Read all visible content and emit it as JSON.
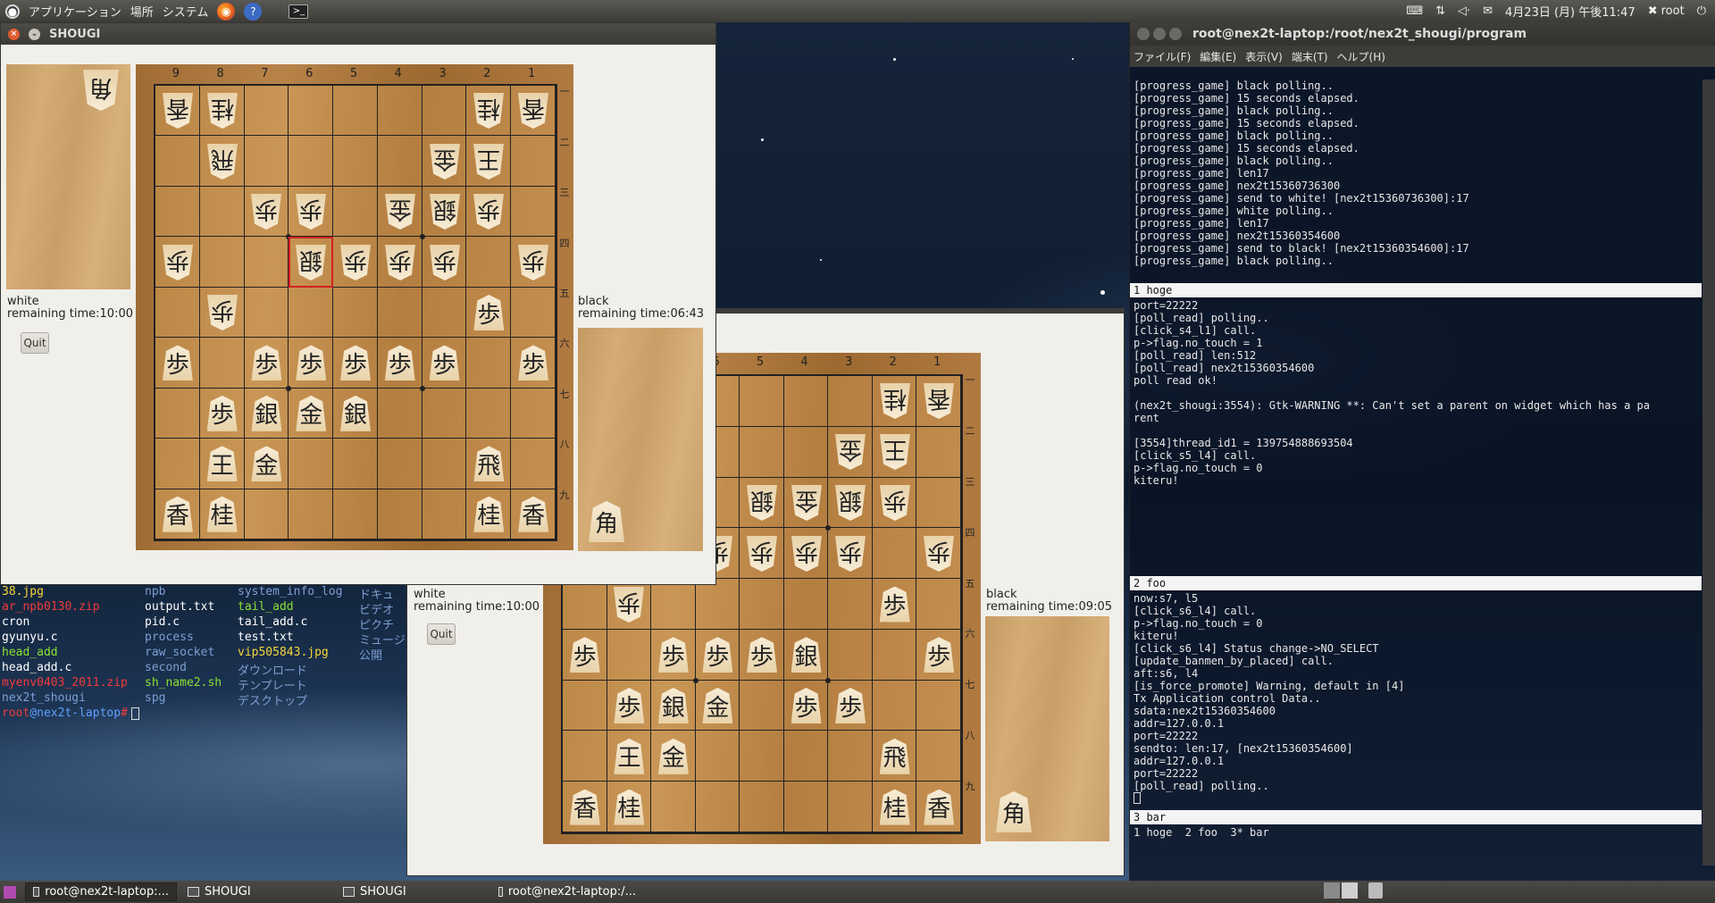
{
  "top_panel": {
    "applications": "アプリケーション",
    "places": "場所",
    "system": "システム",
    "datetime": "4月23日 (月) 午後11:47",
    "user": "root"
  },
  "shogi1": {
    "title": "SHOUGI",
    "white_label": "white",
    "white_time": "remaining time:10:00",
    "black_label": "black",
    "black_time": "remaining time:06:43",
    "quit": "Quit",
    "cols": [
      "9",
      "8",
      "7",
      "6",
      "5",
      "4",
      "3",
      "2",
      "1"
    ],
    "rows": [
      "一",
      "二",
      "三",
      "四",
      "五",
      "六",
      "七",
      "八",
      "九"
    ],
    "captured_white": "角",
    "captured_black": "角",
    "pieces": [
      {
        "c": 9,
        "r": 1,
        "k": "香",
        "w": true
      },
      {
        "c": 8,
        "r": 1,
        "k": "桂",
        "w": true
      },
      {
        "c": 2,
        "r": 1,
        "k": "桂",
        "w": true
      },
      {
        "c": 1,
        "r": 1,
        "k": "香",
        "w": true
      },
      {
        "c": 8,
        "r": 2,
        "k": "飛",
        "w": true
      },
      {
        "c": 3,
        "r": 2,
        "k": "金",
        "w": true
      },
      {
        "c": 2,
        "r": 2,
        "k": "王",
        "w": true
      },
      {
        "c": 7,
        "r": 3,
        "k": "歩",
        "w": true
      },
      {
        "c": 6,
        "r": 3,
        "k": "歩",
        "w": true
      },
      {
        "c": 4,
        "r": 3,
        "k": "金",
        "w": true
      },
      {
        "c": 3,
        "r": 3,
        "k": "銀",
        "w": true
      },
      {
        "c": 2,
        "r": 3,
        "k": "歩",
        "w": true
      },
      {
        "c": 9,
        "r": 4,
        "k": "歩",
        "w": true
      },
      {
        "c": 6,
        "r": 4,
        "k": "銀",
        "w": true
      },
      {
        "c": 5,
        "r": 4,
        "k": "歩",
        "w": true
      },
      {
        "c": 4,
        "r": 4,
        "k": "歩",
        "w": true
      },
      {
        "c": 3,
        "r": 4,
        "k": "歩",
        "w": true
      },
      {
        "c": 1,
        "r": 4,
        "k": "歩",
        "w": true
      },
      {
        "c": 8,
        "r": 5,
        "k": "歩",
        "w": true
      },
      {
        "c": 2,
        "r": 5,
        "k": "歩",
        "w": false
      },
      {
        "c": 9,
        "r": 6,
        "k": "歩",
        "w": false
      },
      {
        "c": 7,
        "r": 6,
        "k": "歩",
        "w": false
      },
      {
        "c": 6,
        "r": 6,
        "k": "歩",
        "w": false
      },
      {
        "c": 5,
        "r": 6,
        "k": "歩",
        "w": false
      },
      {
        "c": 4,
        "r": 6,
        "k": "歩",
        "w": false
      },
      {
        "c": 3,
        "r": 6,
        "k": "歩",
        "w": false
      },
      {
        "c": 1,
        "r": 6,
        "k": "歩",
        "w": false
      },
      {
        "c": 8,
        "r": 7,
        "k": "歩",
        "w": false
      },
      {
        "c": 7,
        "r": 7,
        "k": "銀",
        "w": false
      },
      {
        "c": 6,
        "r": 7,
        "k": "金",
        "w": false
      },
      {
        "c": 5,
        "r": 7,
        "k": "銀",
        "w": false
      },
      {
        "c": 8,
        "r": 8,
        "k": "王",
        "w": false
      },
      {
        "c": 7,
        "r": 8,
        "k": "金",
        "w": false
      },
      {
        "c": 2,
        "r": 8,
        "k": "飛",
        "w": false
      },
      {
        "c": 9,
        "r": 9,
        "k": "香",
        "w": false
      },
      {
        "c": 8,
        "r": 9,
        "k": "桂",
        "w": false
      },
      {
        "c": 2,
        "r": 9,
        "k": "桂",
        "w": false
      },
      {
        "c": 1,
        "r": 9,
        "k": "香",
        "w": false
      }
    ],
    "selected": {
      "c": 6,
      "r": 4
    }
  },
  "shogi2": {
    "title": "SHOUGI",
    "white_label": "white",
    "white_time": "remaining time:10:00",
    "black_label": "black",
    "black_time": "remaining time:09:05",
    "quit": "Quit",
    "cols": [
      "6",
      "5",
      "4",
      "3",
      "2",
      "1"
    ],
    "rows": [
      "一",
      "二",
      "三",
      "四",
      "五",
      "六",
      "七",
      "八",
      "九"
    ],
    "captured_black": "角",
    "pieces": [
      {
        "c": 2,
        "r": 1,
        "k": "桂",
        "w": true
      },
      {
        "c": 1,
        "r": 1,
        "k": "香",
        "w": true
      },
      {
        "c": 3,
        "r": 2,
        "k": "金",
        "w": true
      },
      {
        "c": 2,
        "r": 2,
        "k": "王",
        "w": true
      },
      {
        "c": 5,
        "r": 3,
        "k": "銀",
        "w": true
      },
      {
        "c": 4,
        "r": 3,
        "k": "金",
        "w": true
      },
      {
        "c": 3,
        "r": 3,
        "k": "銀",
        "w": true
      },
      {
        "c": 2,
        "r": 3,
        "k": "歩",
        "w": true
      },
      {
        "c": 6,
        "r": 4,
        "k": "歩",
        "w": true
      },
      {
        "c": 5,
        "r": 4,
        "k": "歩",
        "w": true
      },
      {
        "c": 4,
        "r": 4,
        "k": "歩",
        "w": true
      },
      {
        "c": 3,
        "r": 4,
        "k": "歩",
        "w": true
      },
      {
        "c": 1,
        "r": 4,
        "k": "歩",
        "w": true
      },
      {
        "c": 8,
        "r": 5,
        "k": "歩",
        "w": true
      },
      {
        "c": 2,
        "r": 5,
        "k": "歩",
        "w": false
      },
      {
        "c": 9,
        "r": 6,
        "k": "歩",
        "w": false
      },
      {
        "c": 7,
        "r": 6,
        "k": "歩",
        "w": false
      },
      {
        "c": 6,
        "r": 6,
        "k": "歩",
        "w": false
      },
      {
        "c": 5,
        "r": 6,
        "k": "歩",
        "w": false
      },
      {
        "c": 4,
        "r": 6,
        "k": "銀",
        "w": false
      },
      {
        "c": 1,
        "r": 6,
        "k": "歩",
        "w": false
      },
      {
        "c": 8,
        "r": 7,
        "k": "歩",
        "w": false
      },
      {
        "c": 7,
        "r": 7,
        "k": "銀",
        "w": false
      },
      {
        "c": 6,
        "r": 7,
        "k": "金",
        "w": false
      },
      {
        "c": 4,
        "r": 7,
        "k": "歩",
        "w": false
      },
      {
        "c": 3,
        "r": 7,
        "k": "歩",
        "w": false
      },
      {
        "c": 8,
        "r": 8,
        "k": "王",
        "w": false
      },
      {
        "c": 7,
        "r": 8,
        "k": "金",
        "w": false
      },
      {
        "c": 2,
        "r": 8,
        "k": "飛",
        "w": false
      },
      {
        "c": 9,
        "r": 9,
        "k": "香",
        "w": false
      },
      {
        "c": 8,
        "r": 9,
        "k": "桂",
        "w": false
      },
      {
        "c": 2,
        "r": 9,
        "k": "桂",
        "w": false
      },
      {
        "c": 1,
        "r": 9,
        "k": "香",
        "w": false
      }
    ]
  },
  "terminal": {
    "title": "root@nex2t-laptop:/root/nex2t_shougi/program",
    "menu": [
      "ファイル(F)",
      "編集(E)",
      "表示(V)",
      "端末(T)",
      "ヘルプ(H)"
    ],
    "pane1_lines": [
      "[progress_game] black polling..",
      "[progress_game] 15 seconds elapsed.",
      "[progress_game] black polling..",
      "[progress_game] 15 seconds elapsed.",
      "[progress_game] black polling..",
      "[progress_game] 15 seconds elapsed.",
      "[progress_game] black polling..",
      "[progress_game] len17",
      "[progress_game] nex2t15360736300",
      "[progress_game] send to white! [nex2t15360736300]:17",
      "[progress_game] white polling..",
      "[progress_game] len17",
      "[progress_game] nex2t15360354600",
      "[progress_game] send to black! [nex2t15360354600]:17",
      "[progress_game] black polling.."
    ],
    "pane1_label": "  1  hoge",
    "pane2_lines": [
      "port=22222",
      "[poll_read] polling..",
      "[click_s4_l1] call.",
      "p->flag.no_touch = 1",
      "[poll_read] len:512",
      "[poll_read] nex2t15360354600",
      "poll read ok!",
      "",
      "(nex2t_shougi:3554): Gtk-WARNING **: Can't set a parent on widget which has a pa",
      "rent",
      "",
      "[3554]thread_id1 = 139754888693504",
      "[click_s5_l4] call.",
      "p->flag.no_touch = 0",
      "kiteru!"
    ],
    "pane2_label": "  2  foo",
    "pane3_lines": [
      "now:s7, l5",
      "[click_s6_l4] call.",
      "p->flag.no_touch = 0",
      "kiteru!",
      "[click_s6_l4] Status change->NO_SELECT",
      "[update_banmen_by_placed] call.",
      "aft:s6, l4",
      "[is_force_promote] Warning, default in [4]",
      "Tx Application control Data..",
      "sdata:nex2t15360354600",
      "addr=127.0.0.1",
      "port=22222",
      "sendto: len:17, [nex2t15360354600]",
      "addr=127.0.0.1",
      "port=22222",
      "[poll_read] polling.."
    ],
    "pane3_label": "  3  bar",
    "status_line": "1 hoge  2 foo  3* bar"
  },
  "shell": {
    "columns": [
      [
        {
          "t": "38.jpg",
          "c": "#f5d63a"
        },
        {
          "t": "ar_npb0130.zip",
          "c": "#ef3b3b"
        },
        {
          "t": "cron",
          "c": "#ffffff"
        },
        {
          "t": "gyunyu.c",
          "c": "#ffffff"
        },
        {
          "t": "head_add",
          "c": "#8ae234"
        },
        {
          "t": "head_add.c",
          "c": "#ffffff"
        },
        {
          "t": "myenv0403_2011.zip",
          "c": "#ef3b3b"
        },
        {
          "t": "nex2t_shougi",
          "c": "#7d9fd4"
        }
      ],
      [
        {
          "t": "npb",
          "c": "#7d9fd4"
        },
        {
          "t": "output.txt",
          "c": "#ffffff"
        },
        {
          "t": "pid.c",
          "c": "#ffffff"
        },
        {
          "t": "process",
          "c": "#7d9fd4"
        },
        {
          "t": "raw_socket",
          "c": "#7d9fd4"
        },
        {
          "t": "second",
          "c": "#7d9fd4"
        },
        {
          "t": "sh_name2.sh",
          "c": "#8ae234"
        },
        {
          "t": "spg",
          "c": "#7d9fd4"
        }
      ],
      [
        {
          "t": "system_info_log",
          "c": "#7d9fd4"
        },
        {
          "t": "tail_add",
          "c": "#8ae234"
        },
        {
          "t": "tail_add.c",
          "c": "#ffffff"
        },
        {
          "t": "test.txt",
          "c": "#ffffff"
        },
        {
          "t": "vip505843.jpg",
          "c": "#f5d63a"
        },
        {
          "t": "ダウンロード",
          "c": "#7d9fd4"
        },
        {
          "t": "テンプレート",
          "c": "#7d9fd4"
        },
        {
          "t": "デスクトップ",
          "c": "#7d9fd4"
        }
      ],
      [
        {
          "t": "ドキュ",
          "c": "#7d9fd4"
        },
        {
          "t": "ビデオ",
          "c": "#7d9fd4"
        },
        {
          "t": "ピクチ",
          "c": "#7d9fd4"
        },
        {
          "t": "ミュージ",
          "c": "#7d9fd4"
        },
        {
          "t": "公開",
          "c": "#7d9fd4"
        }
      ]
    ],
    "prompt_user": "root",
    "prompt_host": "@nex2t-laptop",
    "prompt_suffix": "#"
  },
  "taskbar": {
    "tasks": [
      "root@nex2t-laptop:...",
      "SHOUGI",
      "SHOUGI",
      "root@nex2t-laptop:/..."
    ]
  }
}
